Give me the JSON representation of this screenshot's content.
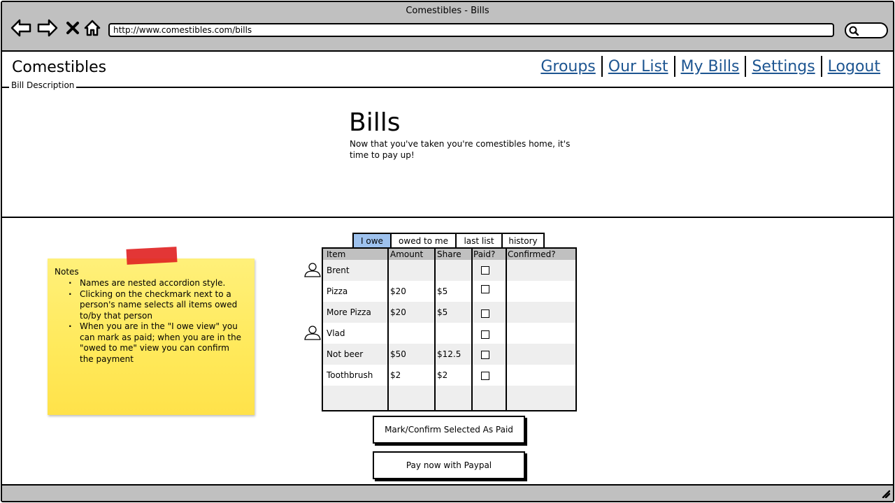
{
  "window": {
    "title": "Comestibles - Bills",
    "url": "http://www.comestibles.com/bills"
  },
  "header": {
    "brand": "Comestibles",
    "nav": [
      "Groups",
      "Our List",
      "My Bills",
      "Settings",
      "Logout"
    ]
  },
  "section": {
    "legend": "Bill Description",
    "title": "Bills",
    "description": "Now that you've taken you're comestibles home, it's time to pay up!"
  },
  "notes": {
    "title": "Notes",
    "items": [
      "Names are nested accordion style.",
      "Clicking on the checkmark next to a person's name selects all items owed to/by that person",
      "When you are in the \"I owe view\" you can mark as paid; when you are in the \"owed to me\" view you can confirm the payment"
    ]
  },
  "tabs": [
    "I owe",
    "owed to me",
    "last list",
    "history"
  ],
  "active_tab": "I owe",
  "table": {
    "columns": [
      "Item",
      "Amount",
      "Share",
      "Paid?",
      "Confirmed?"
    ],
    "rows": [
      {
        "item": "Brent",
        "amount": "",
        "share": "",
        "paid": false,
        "confirmed": "",
        "is_person": true
      },
      {
        "item": "Pizza",
        "amount": "$20",
        "share": "$5",
        "paid": false,
        "confirmed": "",
        "is_person": false
      },
      {
        "item": "More Pizza",
        "amount": "$20",
        "share": "$5",
        "paid": false,
        "confirmed": "",
        "is_person": false
      },
      {
        "item": "Vlad",
        "amount": "",
        "share": "",
        "paid": false,
        "confirmed": "",
        "is_person": true
      },
      {
        "item": "Not beer",
        "amount": "$50",
        "share": "$12.5",
        "paid": false,
        "confirmed": "",
        "is_person": false
      },
      {
        "item": "Toothbrush",
        "amount": "$2",
        "share": "$2",
        "paid": false,
        "confirmed": "",
        "is_person": false
      }
    ]
  },
  "buttons": {
    "mark_paid": "Mark/Confirm Selected As Paid",
    "paypal": "Pay now with Paypal"
  },
  "icons": {
    "back": "arrow-left-icon",
    "forward": "arrow-right-icon",
    "stop": "close-icon",
    "home": "home-icon",
    "search": "search-icon",
    "person": "user-icon",
    "resize": "resize-grip-icon"
  },
  "colors": {
    "chrome": "#c0c0c0",
    "link": "#1d5591",
    "active_tab": "#9ec2ee",
    "sticky_note": "#ffe95a",
    "tape": "#e02020",
    "row_alt": "#eeeeee"
  }
}
